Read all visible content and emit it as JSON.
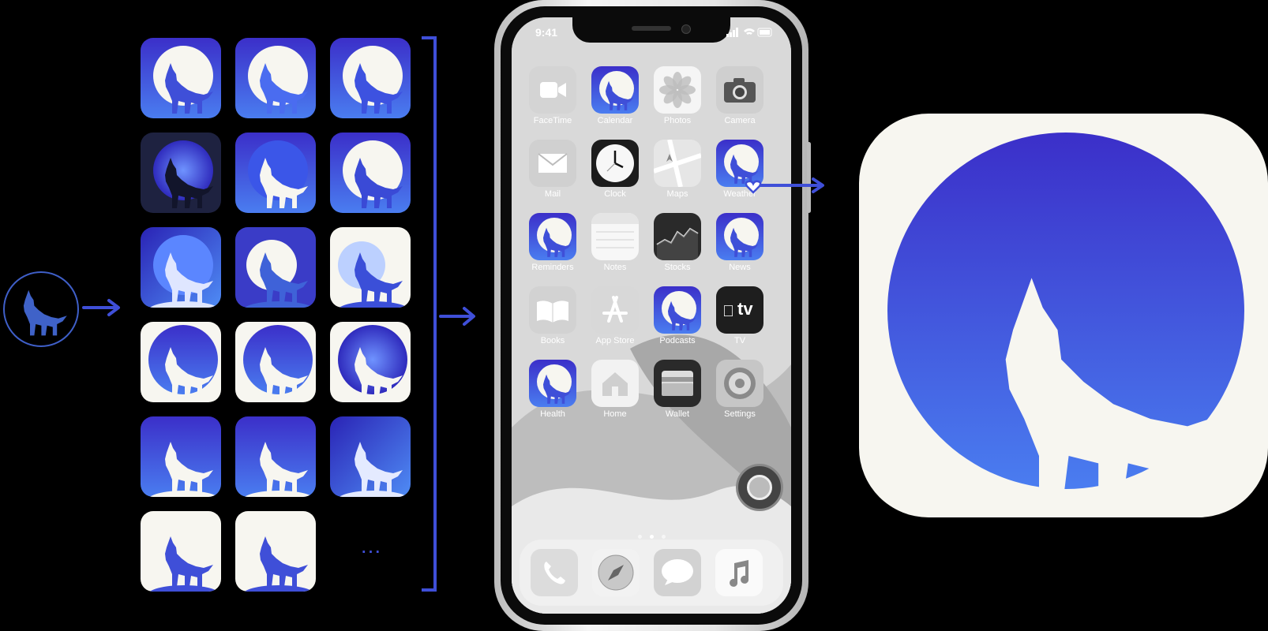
{
  "status_bar": {
    "time": "9:41"
  },
  "home_screen": {
    "apps": [
      {
        "label": "FaceTime",
        "icon": "facetime-icon"
      },
      {
        "label": "Calendar",
        "icon": "wolf-app-icon"
      },
      {
        "label": "Photos",
        "icon": "photos-icon"
      },
      {
        "label": "Camera",
        "icon": "camera-icon"
      },
      {
        "label": "Mail",
        "icon": "mail-icon"
      },
      {
        "label": "Clock",
        "icon": "clock-icon"
      },
      {
        "label": "Maps",
        "icon": "maps-icon"
      },
      {
        "label": "Weather",
        "icon": "wolf-app-icon"
      },
      {
        "label": "Reminders",
        "icon": "wolf-app-icon"
      },
      {
        "label": "Notes",
        "icon": "notes-icon"
      },
      {
        "label": "Stocks",
        "icon": "stocks-icon"
      },
      {
        "label": "News",
        "icon": "wolf-app-icon"
      },
      {
        "label": "Books",
        "icon": "books-icon"
      },
      {
        "label": "App Store",
        "icon": "app-store-icon"
      },
      {
        "label": "Podcasts",
        "icon": "wolf-app-icon"
      },
      {
        "label": "TV",
        "icon": "tv-icon"
      },
      {
        "label": "Health",
        "icon": "wolf-app-icon"
      },
      {
        "label": "Home",
        "icon": "home-icon"
      },
      {
        "label": "Wallet",
        "icon": "wallet-icon"
      },
      {
        "label": "Settings",
        "icon": "settings-icon"
      }
    ],
    "tv_label": "tv",
    "dock": [
      "phone-icon",
      "safari-icon",
      "messages-icon",
      "music-icon"
    ],
    "page_dots": 3,
    "active_page": 2
  },
  "more_indicator": "...",
  "colors": {
    "accent": "#3f4fd8",
    "deep": "#3b2fc9",
    "light": "#f7f6f0",
    "background": "#000000"
  }
}
